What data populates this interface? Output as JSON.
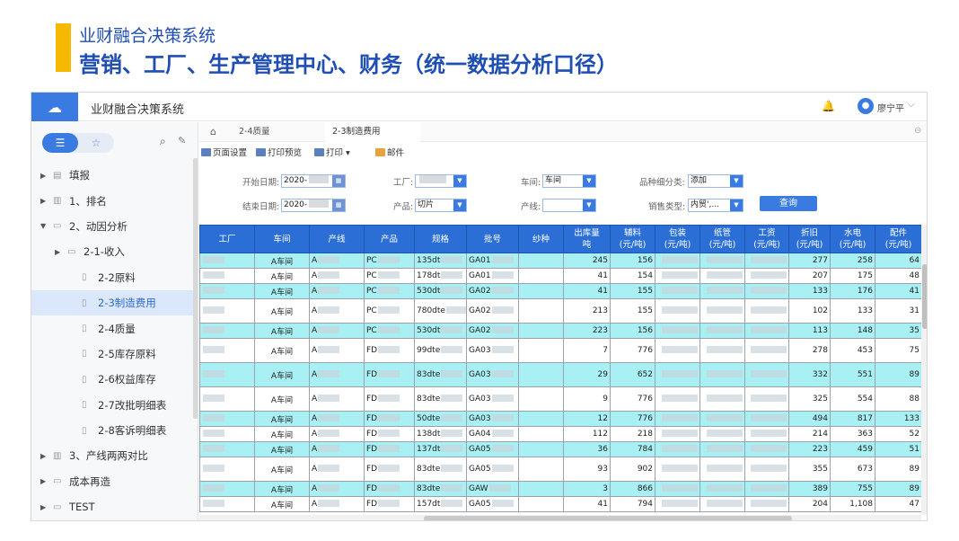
{
  "slide": {
    "title": "业财融合决策系统",
    "subtitle": "营销、工厂、生产管理中心、财务（统一数据分析口径）",
    "accent_color": "#f6b800",
    "title_color": "#1f4fb3"
  },
  "app": {
    "title": "业财融合决策系统",
    "brand_color": "#3a7be2",
    "user_name": "廖宁平",
    "logo_icon": "cloud-logo-icon"
  },
  "sidebar": {
    "items": [
      {
        "label": "填报",
        "level": 0,
        "arrow": "▶",
        "icon": "form-icon"
      },
      {
        "label": "1、排名",
        "level": 0,
        "arrow": "▶",
        "icon": "chart-icon"
      },
      {
        "label": "2、动因分析",
        "level": 0,
        "arrow": "▼",
        "icon": "folder-icon"
      },
      {
        "label": "2-1-收入",
        "level": 1,
        "arrow": "▶",
        "icon": "folder-icon"
      },
      {
        "label": "2-2原料",
        "level": 2,
        "arrow": "",
        "icon": "doc-icon"
      },
      {
        "label": "2-3制造费用",
        "level": 2,
        "arrow": "",
        "icon": "doc-icon",
        "active": true
      },
      {
        "label": "2-4质量",
        "level": 2,
        "arrow": "",
        "icon": "doc-icon"
      },
      {
        "label": "2-5库存原料",
        "level": 2,
        "arrow": "",
        "icon": "doc-icon"
      },
      {
        "label": "2-6权益库存",
        "level": 2,
        "arrow": "",
        "icon": "doc-icon"
      },
      {
        "label": "2-7改批明细表",
        "level": 2,
        "arrow": "",
        "icon": "doc-icon"
      },
      {
        "label": "2-8客诉明细表",
        "level": 2,
        "arrow": "",
        "icon": "doc-icon"
      },
      {
        "label": "3、产线两两对比",
        "level": 0,
        "arrow": "▶",
        "icon": "chart-icon"
      },
      {
        "label": "成本再造",
        "level": 0,
        "arrow": "▶",
        "icon": "folder-icon"
      },
      {
        "label": "TEST",
        "level": 0,
        "arrow": "▶",
        "icon": "folder-icon"
      }
    ]
  },
  "tabs": [
    {
      "label": "2-4质量",
      "active": false
    },
    {
      "label": "2-3制造费用",
      "active": true
    }
  ],
  "toolbar": {
    "page_setup": "页面设置",
    "print_preview": "打印预览",
    "print": "打印",
    "mail": "邮件"
  },
  "filters": {
    "start_date_label": "开始日期:",
    "start_date_value": "2020-",
    "end_date_label": "结束日期:",
    "end_date_value": "2020-",
    "factory_label": "工厂:",
    "workshop_label": "车间:",
    "workshop_value": "车间",
    "product_label": "产品:",
    "product_value": "切片",
    "line_label": "产线:",
    "line_value": "",
    "variety_label": "品种细分类:",
    "variety_value": "添加",
    "sales_type_label": "销售类型:",
    "sales_type_value": "内贸',...",
    "query_button": "查询"
  },
  "table": {
    "headers": [
      "工厂",
      "车间",
      "产线",
      "产品",
      "规格",
      "批号",
      "纱种",
      "出库量\n吨",
      "辅料\n(元/吨)",
      "包装\n(元/吨)",
      "纸管\n(元/吨)",
      "工资\n(元/吨)",
      "折旧\n(元/吨)",
      "水电\n(元/吨)",
      "配件\n(元/吨)"
    ],
    "rows": [
      {
        "cyan": true,
        "tall": false,
        "cells": [
          "",
          "A车间",
          "A",
          "PC",
          "135dt",
          "GA01",
          "",
          "245",
          "156",
          "",
          "",
          "",
          "277",
          "258",
          "64"
        ]
      },
      {
        "cyan": false,
        "tall": false,
        "cells": [
          "",
          "A车间",
          "A",
          "PC",
          "178dt",
          "GA01",
          "",
          "41",
          "154",
          "",
          "",
          "",
          "207",
          "175",
          "48"
        ]
      },
      {
        "cyan": true,
        "tall": false,
        "cells": [
          "",
          "A车间",
          "A",
          "PC",
          "530dt",
          "GA02",
          "",
          "41",
          "155",
          "",
          "",
          "",
          "133",
          "176",
          "41"
        ]
      },
      {
        "cyan": false,
        "tall": true,
        "cells": [
          "",
          "A车间",
          "A",
          "PC",
          "780dte",
          "GA02",
          "",
          "213",
          "155",
          "",
          "",
          "",
          "102",
          "133",
          "31"
        ]
      },
      {
        "cyan": true,
        "tall": false,
        "cells": [
          "",
          "A车间",
          "A",
          "PC",
          "530dt",
          "GA02",
          "",
          "223",
          "156",
          "",
          "",
          "",
          "113",
          "148",
          "35"
        ]
      },
      {
        "cyan": false,
        "tall": true,
        "cells": [
          "",
          "A车间",
          "A",
          "FD",
          "99dte",
          "GA03",
          "",
          "7",
          "776",
          "",
          "",
          "",
          "278",
          "453",
          "75"
        ]
      },
      {
        "cyan": true,
        "tall": true,
        "cells": [
          "",
          "A车间",
          "A",
          "FD",
          "83dte",
          "GA03",
          "",
          "29",
          "652",
          "",
          "",
          "",
          "332",
          "551",
          "89"
        ]
      },
      {
        "cyan": false,
        "tall": true,
        "cells": [
          "",
          "A车间",
          "A",
          "FD",
          "83dte",
          "GA03",
          "",
          "9",
          "776",
          "",
          "",
          "",
          "325",
          "554",
          "88"
        ]
      },
      {
        "cyan": true,
        "tall": false,
        "cells": [
          "",
          "A车间",
          "A",
          "FD",
          "50dte",
          "GA03",
          "",
          "12",
          "776",
          "",
          "",
          "",
          "494",
          "817",
          "133"
        ]
      },
      {
        "cyan": false,
        "tall": false,
        "cells": [
          "",
          "A车间",
          "A",
          "FD",
          "138dt",
          "GA04",
          "",
          "112",
          "218",
          "",
          "",
          "",
          "214",
          "363",
          "52"
        ]
      },
      {
        "cyan": true,
        "tall": false,
        "cells": [
          "",
          "A车间",
          "A",
          "FD",
          "137dt",
          "GA05",
          "",
          "36",
          "784",
          "",
          "",
          "",
          "223",
          "459",
          "51"
        ]
      },
      {
        "cyan": false,
        "tall": true,
        "cells": [
          "",
          "A车间",
          "A",
          "FD",
          "83dte",
          "GA05",
          "",
          "93",
          "902",
          "",
          "",
          "",
          "355",
          "673",
          "89"
        ]
      },
      {
        "cyan": true,
        "tall": false,
        "cells": [
          "",
          "A车间",
          "A",
          "FD",
          "83dte",
          "GAW",
          "",
          "3",
          "866",
          "",
          "",
          "",
          "389",
          "755",
          "89"
        ]
      },
      {
        "cyan": false,
        "tall": false,
        "cells": [
          "",
          "A车间",
          "A",
          "FD",
          "157dt",
          "GA05",
          "",
          "41",
          "794",
          "",
          "",
          "",
          "204",
          "1,108",
          "47"
        ]
      }
    ]
  }
}
